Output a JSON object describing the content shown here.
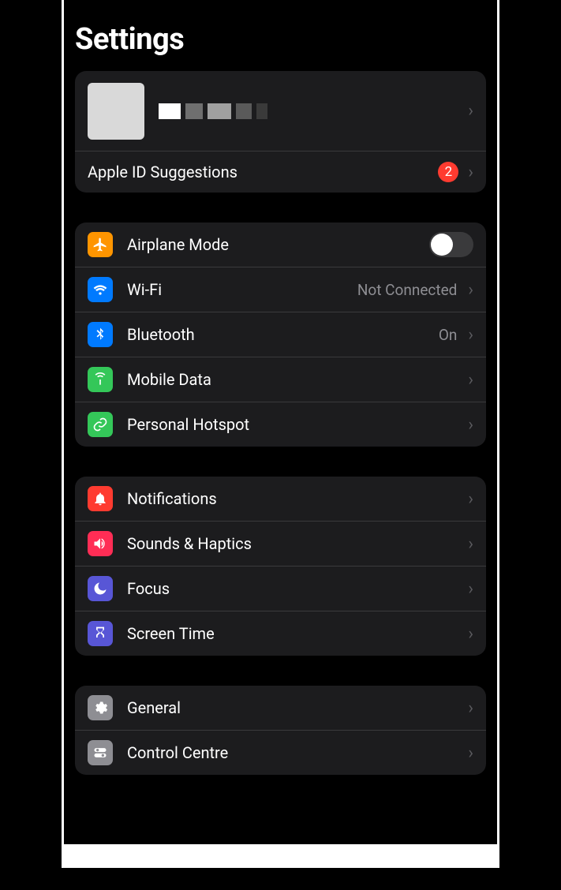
{
  "header": {
    "title": "Settings"
  },
  "apple_id": {
    "suggestions_label": "Apple ID Suggestions",
    "suggestions_badge": "2"
  },
  "g1": {
    "airplane": {
      "label": "Airplane Mode",
      "color": "#ff9500"
    },
    "wifi": {
      "label": "Wi-Fi",
      "value": "Not Connected",
      "color": "#007aff"
    },
    "bluetooth": {
      "label": "Bluetooth",
      "value": "On",
      "color": "#007aff"
    },
    "mobile": {
      "label": "Mobile Data",
      "color": "#34c759"
    },
    "hotspot": {
      "label": "Personal Hotspot",
      "color": "#34c759"
    }
  },
  "g2": {
    "notifications": {
      "label": "Notifications",
      "color": "#ff3b30"
    },
    "sounds": {
      "label": "Sounds & Haptics",
      "color": "#ff2d55"
    },
    "focus": {
      "label": "Focus",
      "color": "#5856d6"
    },
    "screentime": {
      "label": "Screen Time",
      "color": "#5856d6"
    }
  },
  "g3": {
    "general": {
      "label": "General",
      "color": "#8e8e93"
    },
    "control": {
      "label": "Control Centre",
      "color": "#8e8e93"
    }
  }
}
